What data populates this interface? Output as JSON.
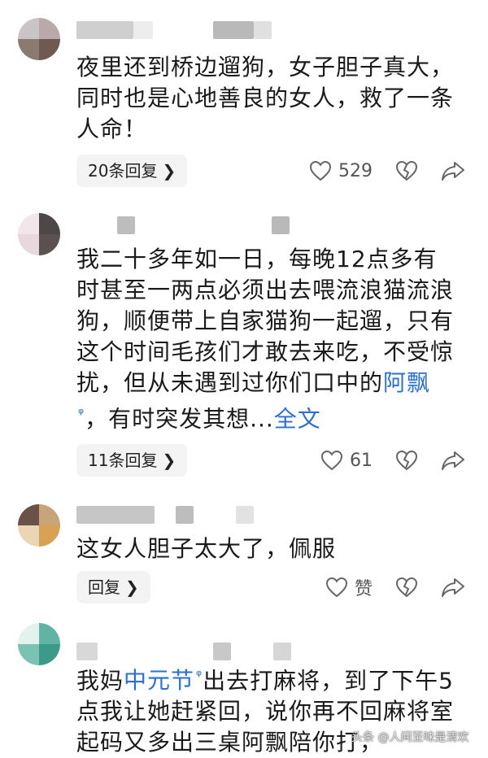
{
  "colors": {
    "link": "#2a6fd6",
    "reply_bg": "#f3f3f3",
    "icon": "#666666"
  },
  "comments": [
    {
      "text_html_parts": [
        "夜里还到桥边遛狗，女子胆子真大，同时也是心地善良的女人，救了一条人命！"
      ],
      "replies_label": "20条回复",
      "likes": "529"
    },
    {
      "text_before": "我二十多年如一日，每晚12点多有时甚至一两点必须出去喂流浪猫流浪狗，顺便带上自家猫狗一起遛，只有这个时间毛孩们才敢去来吃，不受惊扰，但从未遇到过你们口中的",
      "link": "阿飘",
      "text_after": "，有时突发其想...",
      "full_text_link": "全文",
      "replies_label": "11条回复",
      "likes": "61"
    },
    {
      "text": "这女人胆子太大了，佩服",
      "replies_label": "回复",
      "likes": "赞"
    },
    {
      "text_before": "我妈",
      "link": "中元节",
      "text_after": "出去打麻将，到了下午5点我让她赶紧回，说你再不回麻将室起码又多出三桌阿飘陪你打，"
    }
  ],
  "watermark": "头条 @人间至味是清欢",
  "icons": {
    "like": "heart-icon",
    "dislike": "broken-heart-icon",
    "share": "share-arrow-icon",
    "chevron": "chevron-right-icon",
    "search": "search-icon"
  }
}
